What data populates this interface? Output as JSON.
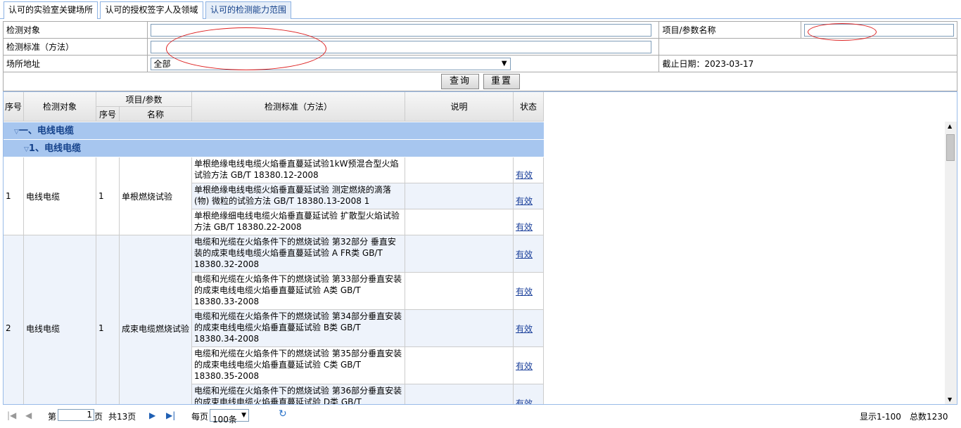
{
  "tabs": [
    "认可的实验室关键场所",
    "认可的授权签字人及领域",
    "认可的检测能力范围"
  ],
  "form": {
    "object_label": "检测对象",
    "object_value": "",
    "param_label": "项目/参数名称",
    "param_value": "",
    "standard_label": "检测标准（方法）",
    "standard_value": "",
    "site_label": "场所地址",
    "site_value": "全部",
    "deadline": "截止日期：2023-03-17"
  },
  "buttons": {
    "search": "查询",
    "reset": "重置"
  },
  "columns": {
    "no": "序号",
    "object": "检测对象",
    "param_group": "项目/参数",
    "param_no": "序号",
    "param_name": "名称",
    "standard": "检测标准（方法）",
    "desc": "说明",
    "status": "状态"
  },
  "groups": {
    "g1": "一、电线电缆",
    "g2": "1、电线电缆"
  },
  "rows": [
    {
      "no": "1",
      "object": "电线电缆",
      "pno": "1",
      "pname": "单根燃烧试验",
      "standards": [
        "单根绝缘电线电缆火焰垂直蔓延试验1kW预混合型火焰试验方法 GB/T 18380.12-2008",
        "单根绝缘电线电缆火焰垂直蔓延试验 测定燃烧的滴落(物) 微粒的试验方法 GB/T 18380.13-2008 1",
        "单根绝缘细电线电缆火焰垂直蔓延试验 扩散型火焰试验方法 GB/T 18380.22-2008"
      ]
    },
    {
      "no": "2",
      "object": "电线电缆",
      "pno": "1",
      "pname": "成束电缆燃烧试验",
      "standards": [
        "电缆和光缆在火焰条件下的燃烧试验 第32部分 垂直安装的成束电线电缆火焰垂直蔓延试验 A FR类 GB/T 18380.32-2008",
        "电缆和光缆在火焰条件下的燃烧试验 第33部分垂直安装的成束电线电缆火焰垂直蔓延试验 A类 GB/T 18380.33-2008",
        "电缆和光缆在火焰条件下的燃烧试验 第34部分垂直安装的成束电线电缆火焰垂直蔓延试验 B类 GB/T 18380.34-2008",
        "电缆和光缆在火焰条件下的燃烧试验 第35部分垂直安装的成束电线电缆火焰垂直蔓延试验 C类 GB/T 18380.35-2008",
        "电缆和光缆在火焰条件下的燃烧试验 第36部分垂直安装的成束电线电缆火焰垂直蔓延试验 D类 GB/T"
      ]
    }
  ],
  "status_text": "有效",
  "pager": {
    "page_prefix": "第",
    "page_value": "1",
    "page_suffix": "页",
    "total_pages": "共13页",
    "per_page": "每页",
    "per_page_value": "100条",
    "display": "显示1-100",
    "total": "总数1230"
  },
  "colors": {
    "accent": "#15428b",
    "group_bg": "#a7c6ef",
    "annotation": "#dd2222"
  }
}
